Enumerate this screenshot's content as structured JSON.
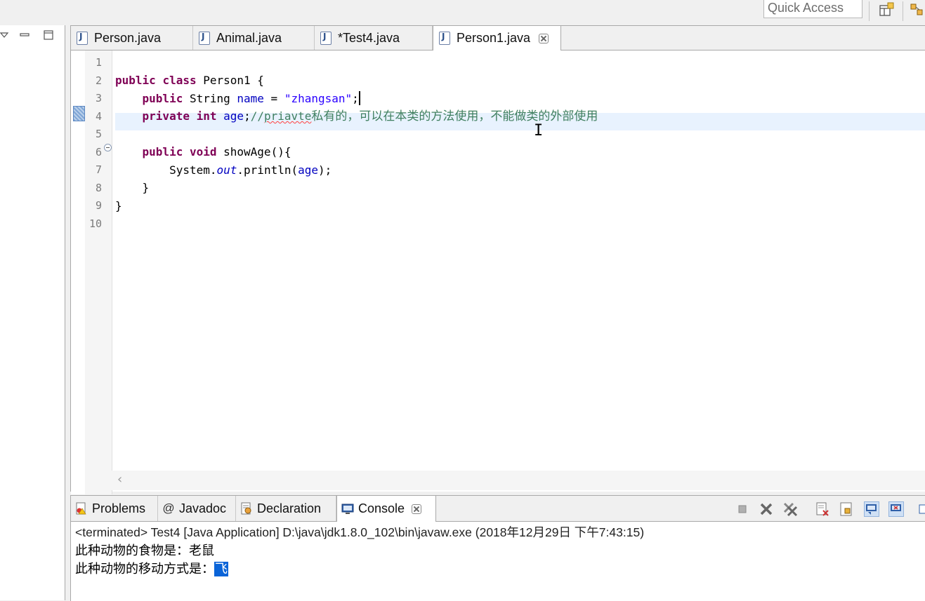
{
  "toolbar": {
    "quick_access": "Quick Access"
  },
  "editor": {
    "tabs": [
      {
        "label": "Person.java",
        "active": false
      },
      {
        "label": "Animal.java",
        "active": false
      },
      {
        "label": "*Test4.java",
        "active": false
      },
      {
        "label": "Person1.java",
        "active": true
      }
    ],
    "line_numbers": [
      "1",
      "2",
      "3",
      "4",
      "5",
      "6",
      "7",
      "8",
      "9",
      "10"
    ],
    "code": {
      "line2": {
        "kw1": "public",
        "kw2": "class",
        "name": " Person1 {"
      },
      "line3": {
        "kw1": "public",
        "type": " String ",
        "field": "name",
        "eq": " = ",
        "str": "\"zhangsan\"",
        "end": ";"
      },
      "line4": {
        "kw1": "private",
        "kw2": "int",
        "field": "age",
        "semi": ";",
        "comment_prefix": "//",
        "comment_word": "priavte",
        "comment_text": "私有的，可以在本类的方法使用，不能做类的外部使用"
      },
      "line6": {
        "kw1": "public",
        "kw2": "void",
        "rest": " showAge(){"
      },
      "line7": {
        "pre": "System.",
        "static_field": "out",
        "mid": ".println(",
        "field": "age",
        "end": ");"
      },
      "line8": "}",
      "line9": "}"
    }
  },
  "console": {
    "tabs": [
      {
        "label": "Problems",
        "icon": "problems-icon",
        "active": false
      },
      {
        "label": "Javadoc",
        "icon": "at-icon",
        "active": false
      },
      {
        "label": "Declaration",
        "icon": "declaration-icon",
        "active": false
      },
      {
        "label": "Console",
        "icon": "console-icon",
        "active": true
      }
    ],
    "header": "<terminated> Test4 [Java Application] D:\\java\\jdk1.8.0_102\\bin\\javaw.exe (2018年12月29日 下午7:43:15)",
    "output": {
      "line1": "此种动物的食物是：老鼠",
      "line2_prefix": "此种动物的移动方式是：",
      "line2_selected": "飞"
    }
  },
  "colors": {
    "keyword": "#7f0055",
    "string": "#2a00ff",
    "field": "#0000c0",
    "comment": "#3f7f5f",
    "current_line": "#e8f2fe",
    "selection": "#0a64d8"
  }
}
